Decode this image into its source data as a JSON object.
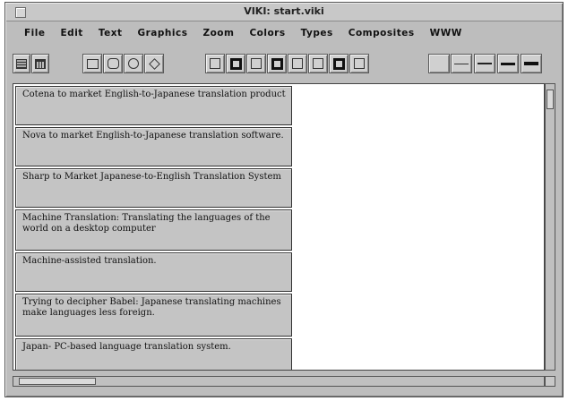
{
  "window": {
    "title": "VIKI: start.viki"
  },
  "menu": [
    "File",
    "Edit",
    "Text",
    "Graphics",
    "Zoom",
    "Colors",
    "Types",
    "Composites",
    "WWW"
  ],
  "toolbar": {
    "file_tools": [
      "list-icon",
      "document-icon"
    ],
    "shape_tools": [
      "rectangle-icon",
      "rounded-rectangle-icon",
      "circle-icon",
      "diamond-icon"
    ],
    "border_tools": [
      "thin-square-icon",
      "thick-square-icon",
      "thin-square-icon",
      "thick-square-icon",
      "thin-square-icon",
      "thin-square-icon",
      "thick-square-icon",
      "thin-square-icon"
    ],
    "line_tools": [
      "no-line-icon",
      "thin-line-icon",
      "medium-line-icon",
      "thick-line-icon",
      "thickest-line-icon"
    ]
  },
  "nodes": [
    {
      "text": "Cotena to market English-to-Japanese translation product"
    },
    {
      "text": "Nova to market English-to-Japanese translation software."
    },
    {
      "text": "Sharp to Market Japanese-to-English Translation System"
    },
    {
      "text": "Machine Translation: Translating the languages of the world on a desktop computer"
    },
    {
      "text": "Machine-assisted translation."
    },
    {
      "text": "Trying to decipher Babel: Japanese translating machines make languages less foreign."
    },
    {
      "text": "Japan- PC-based language translation system."
    }
  ]
}
